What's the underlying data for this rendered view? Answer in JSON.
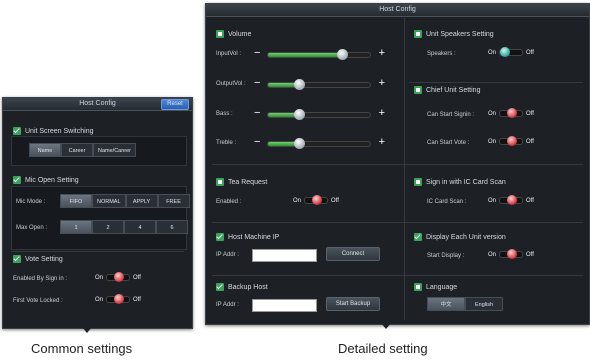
{
  "left": {
    "title": "Host Config",
    "reset_label": "Reset",
    "unit_screen": {
      "heading": "Unit Screen Switching",
      "options": [
        "Name",
        "Career",
        "Name/Career"
      ],
      "selected": 0
    },
    "mic_open": {
      "heading": "Mic Open Setting",
      "mode_label": "Mic Mode :",
      "modes": [
        "FIFO",
        "NORMAL",
        "APPLY",
        "FREE"
      ],
      "selected_mode": 0,
      "max_label": "Max Open :",
      "max_values": [
        "1",
        "2",
        "4",
        "6"
      ],
      "selected_max": 0
    },
    "vote": {
      "heading": "Vote Setting",
      "rows": [
        {
          "label": "Enabled By Sign in :",
          "on": "On",
          "off": "Off"
        },
        {
          "label": "First Vote Locked :",
          "on": "On",
          "off": "Off"
        }
      ]
    },
    "caption": "Common settings"
  },
  "right": {
    "title": "Host Config",
    "volume": {
      "heading": "Volume",
      "rows": [
        {
          "label": "InputVol :",
          "level": 0.73
        },
        {
          "label": "OutputVol :",
          "level": 0.3
        },
        {
          "label": "Bass :",
          "level": 0.3
        },
        {
          "label": "Treble :",
          "level": 0.3
        }
      ]
    },
    "speakers": {
      "heading": "Unit Speakers Setting",
      "label": "Speakers :",
      "on": "On",
      "off": "Off"
    },
    "chief": {
      "heading": "Chief Unit Setting",
      "rows": [
        {
          "label": "Can Start Signin :",
          "on": "On",
          "off": "Off"
        },
        {
          "label": "Can Start Vote :",
          "on": "On",
          "off": "Off"
        }
      ]
    },
    "tea": {
      "heading": "Tea Request",
      "label": "Enabled :",
      "on": "On",
      "off": "Off"
    },
    "sign_ic": {
      "heading": "Sign in with IC Card Scan",
      "label": "IC Card Scan :",
      "on": "On",
      "off": "Off"
    },
    "host_ip": {
      "heading": "Host Machine IP",
      "label": "IP Addr :",
      "value": "",
      "button": "Connect"
    },
    "display_unit": {
      "heading": "Display Each Unit version",
      "label": "Start Display :",
      "on": "On",
      "off": "Off"
    },
    "backup": {
      "heading": "Backup Host",
      "label": "IP Addr :",
      "value": "",
      "button": "Start Backup"
    },
    "language": {
      "heading": "Language",
      "options": [
        "中文",
        "English"
      ],
      "selected": 0
    },
    "caption": "Detailed setting"
  }
}
